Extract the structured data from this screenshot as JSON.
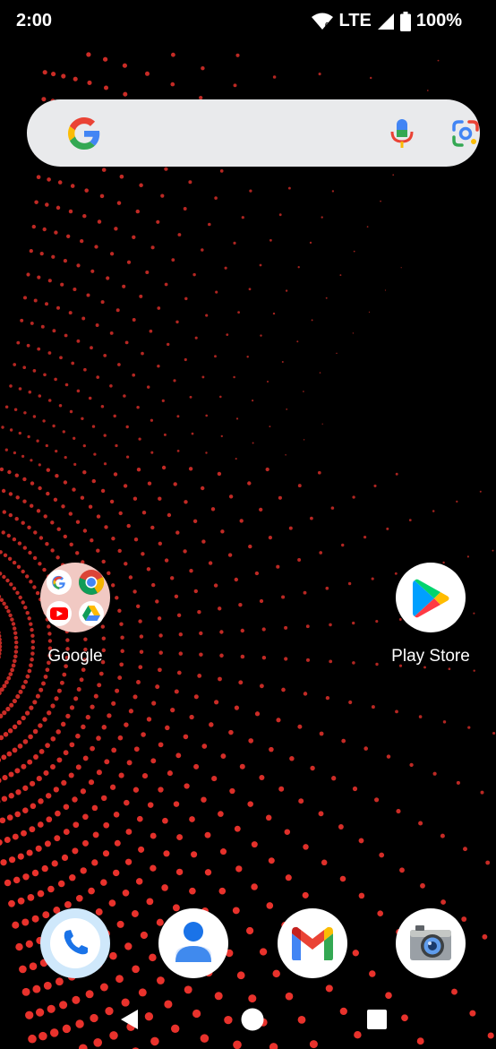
{
  "status_bar": {
    "time": "2:00",
    "network": "LTE",
    "battery": "100%"
  },
  "search": {
    "icons": [
      "google-g-icon",
      "mic-icon",
      "lens-icon"
    ]
  },
  "home_apps": [
    {
      "label": "Google",
      "icon": "google-folder-icon"
    },
    {
      "label": "Play Store",
      "icon": "play-store-icon"
    }
  ],
  "dock": [
    {
      "icon": "phone-icon"
    },
    {
      "icon": "contacts-icon"
    },
    {
      "icon": "gmail-icon"
    },
    {
      "icon": "camera-icon"
    }
  ],
  "nav": {
    "buttons": [
      "back-icon",
      "home-icon",
      "recents-icon"
    ]
  },
  "colors": {
    "wallpaper_dot": "#e8322c",
    "search_bg": "#e9eaec"
  }
}
